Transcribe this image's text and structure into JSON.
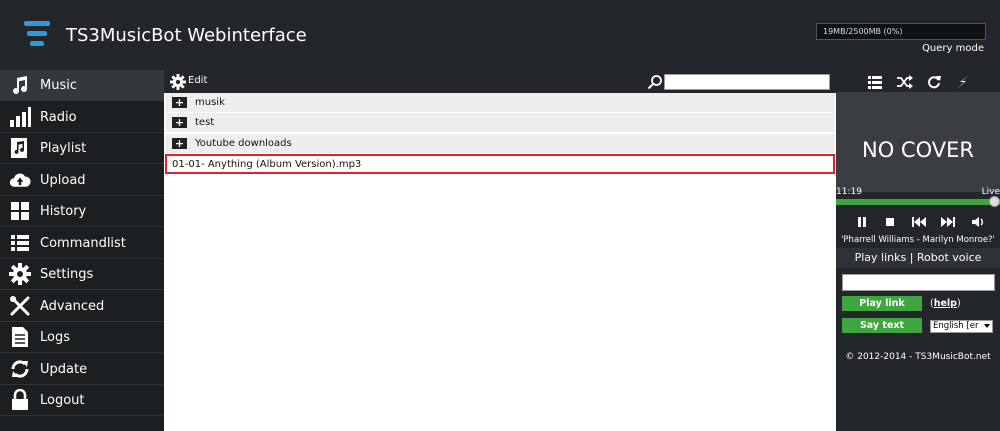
{
  "header": {
    "title": "TS3MusicBot Webinterface",
    "storage": "19MB/2500MB (0%)",
    "mode": "Query mode"
  },
  "sidebar": {
    "items": [
      {
        "label": "Music",
        "icon": "music-note-icon"
      },
      {
        "label": "Radio",
        "icon": "signal-bars-icon"
      },
      {
        "label": "Playlist",
        "icon": "playlist-icon"
      },
      {
        "label": "Upload",
        "icon": "cloud-upload-icon"
      },
      {
        "label": "History",
        "icon": "grid-icon"
      },
      {
        "label": "Commandlist",
        "icon": "list-icon"
      },
      {
        "label": "Settings",
        "icon": "gear-icon"
      },
      {
        "label": "Advanced",
        "icon": "tools-icon"
      },
      {
        "label": "Logs",
        "icon": "document-icon"
      },
      {
        "label": "Update",
        "icon": "refresh-icon"
      },
      {
        "label": "Logout",
        "icon": "lock-icon"
      }
    ]
  },
  "toolbar": {
    "edit_label": "Edit",
    "search_placeholder": ""
  },
  "folders": [
    {
      "label": "musik"
    },
    {
      "label": "test"
    },
    {
      "label": "Youtube downloads"
    }
  ],
  "selected_file": "01-01- Anything (Album Version).mp3",
  "player": {
    "cover_text": "NO COVER",
    "elapsed": "11:19",
    "live": "Live",
    "progress_fraction": 0.99,
    "track_title": "'Pharrell Williams - Marilyn Monroe?'",
    "links_header": "Play links | Robot voice",
    "play_link_label": "Play link",
    "help_open": "(",
    "help_label": "help",
    "help_close": ")",
    "say_text_label": "Say text",
    "language_value": "English [er",
    "copyright": "© 2012-2014 - TS3MusicBot.net"
  },
  "colors": {
    "accent_blue": "#2f9ad8",
    "green": "#3fa53f",
    "highlight_red": "#e0222a"
  }
}
